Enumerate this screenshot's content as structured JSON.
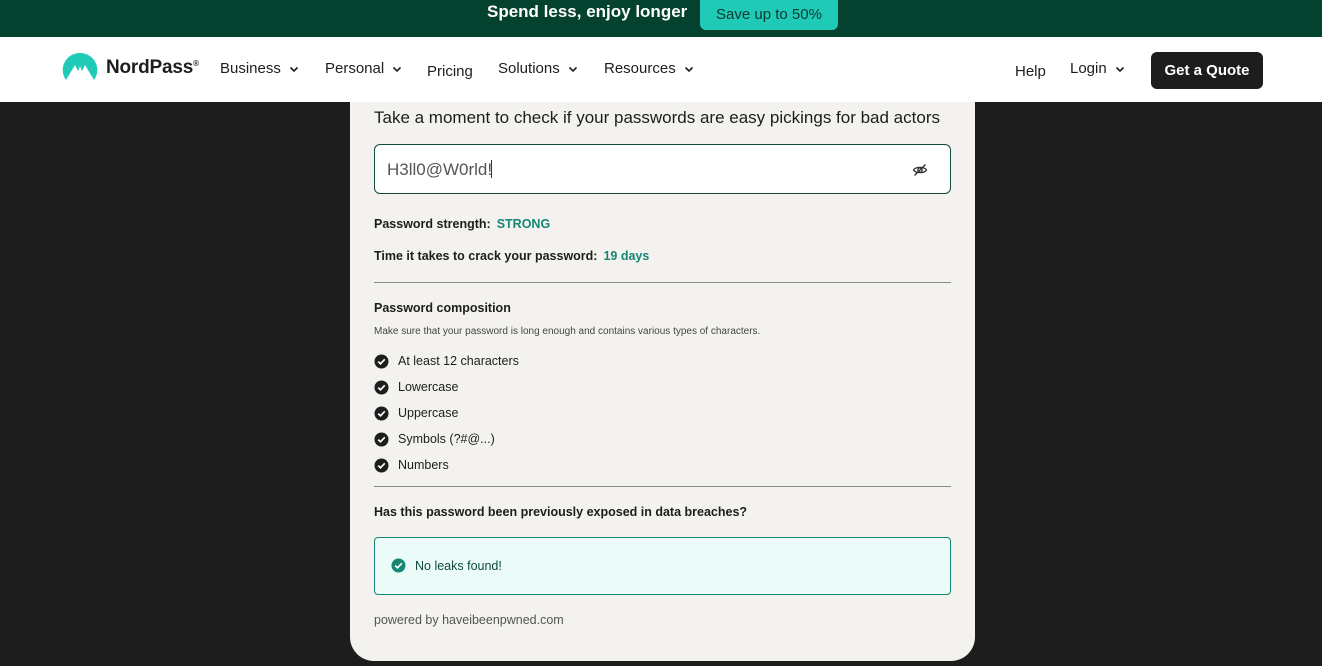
{
  "promo": {
    "text": "Spend less, enjoy longer",
    "button_label": "Save up to 50%"
  },
  "nav": {
    "brand": "NordPass",
    "brand_mark": "®",
    "items": [
      {
        "label": "Business",
        "has_dropdown": true
      },
      {
        "label": "Personal",
        "has_dropdown": true
      },
      {
        "label": "Pricing",
        "has_dropdown": false
      },
      {
        "label": "Solutions",
        "has_dropdown": true
      },
      {
        "label": "Resources",
        "has_dropdown": true
      }
    ],
    "help_label": "Help",
    "login_label": "Login",
    "cta_label": "Get a Quote"
  },
  "checker": {
    "intro": "Take a moment to check if your passwords are easy pickings for bad actors",
    "password_value": "H3ll0@W0rld!",
    "strength_label": "Password strength:",
    "strength_value": "STRONG",
    "crack_label": "Time it takes to crack your password:",
    "crack_value": "19 days",
    "composition_title": "Password composition",
    "composition_hint": "Make sure that your password is long enough and contains various types of characters.",
    "criteria": [
      "At least 12 characters",
      "Lowercase",
      "Uppercase",
      "Symbols (?#@...)",
      "Numbers"
    ],
    "breach_question": "Has this password been previously exposed in data breaches?",
    "breach_result": "No leaks found!",
    "powered_by": "powered by haveibeenpwned.com"
  },
  "colors": {
    "promo_bg": "#04412f",
    "accent": "#1fcab6",
    "teal_text": "#168775",
    "dark": "#1d1d1d",
    "card_bg": "#f4f2ee"
  },
  "icons": {
    "visibility_toggle": "eye-slash-icon",
    "criteria_check": "check-circle-icon",
    "dropdown": "chevron-down-icon"
  }
}
